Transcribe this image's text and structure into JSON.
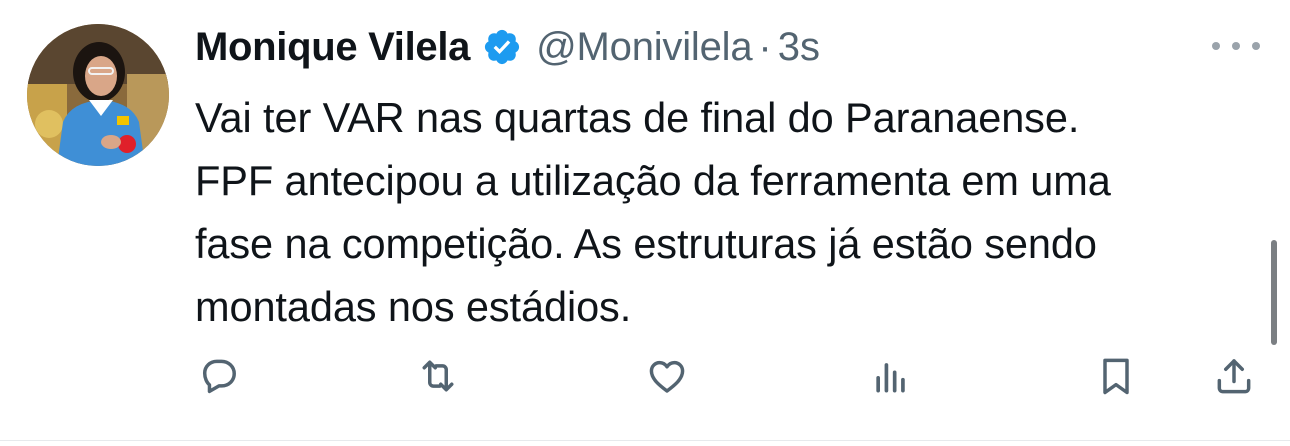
{
  "tweet": {
    "author": {
      "display_name": "Monique Vilela",
      "handle": "@Monivilela",
      "verified_icon": "verified-badge-icon",
      "avatar": "avatar"
    },
    "separator": "·",
    "time": "3s",
    "more_icon": "more-options-icon",
    "text_lines": [
      "Vai ter VAR nas quartas de final do Paranaense.",
      "FPF antecipou a utilização da ferramenta em uma",
      "fase na competição. As estruturas já estão sendo",
      "montadas nos estádios."
    ],
    "actions": [
      {
        "icon": "reply-icon"
      },
      {
        "icon": "retweet-icon"
      },
      {
        "icon": "like-icon"
      },
      {
        "icon": "views-icon"
      },
      {
        "icon": "bookmark-icon"
      },
      {
        "icon": "share-icon"
      }
    ]
  },
  "colors": {
    "text_primary": "#0f1419",
    "text_secondary": "#536471",
    "verified_blue": "#1d9bf0",
    "icon_gray": "#536471"
  }
}
